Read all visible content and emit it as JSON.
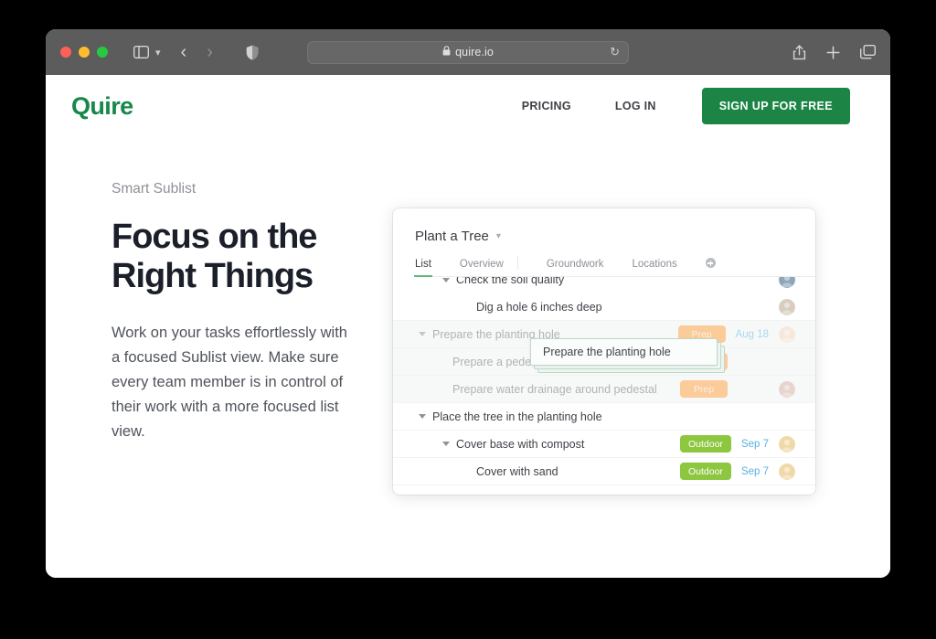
{
  "browser": {
    "url": "quire.io",
    "lock_icon": "lock-icon",
    "reload_icon": "reload-icon",
    "sidebar_icon": "sidebar-toggle-icon",
    "back_icon": "chevron-left-icon",
    "forward_icon": "chevron-right-icon",
    "shield_icon": "shield-icon",
    "share_icon": "share-icon",
    "new_tab_icon": "plus-icon",
    "tabs_icon": "tab-overview-icon",
    "traffic_lights": [
      "close-red",
      "minimize-yellow",
      "maximize-green"
    ]
  },
  "header": {
    "logo": "Quire",
    "nav": [
      {
        "label": "PRICING"
      },
      {
        "label": "LOG IN"
      }
    ],
    "cta": "SIGN UP FOR FREE"
  },
  "hero": {
    "eyebrow": "Smart Sublist",
    "title_line1": "Focus on the",
    "title_line2": "Right Things",
    "body": "Work on your tasks effortlessly with a focused Sublist view. Make sure every team member is in control of their work with a more focused list view."
  },
  "app": {
    "project_name": "Plant a Tree",
    "project_chevron": "⌄",
    "tabs": [
      {
        "label": "List",
        "active": true
      },
      {
        "label": "Overview",
        "active": false
      },
      {
        "label": "Groundwork",
        "active": false
      },
      {
        "label": "Locations",
        "active": false
      }
    ],
    "add_tab_label": "",
    "rows": [
      {
        "title": "Check the soil quality",
        "indent": 1,
        "caret": true,
        "badge": null,
        "badge_type": null,
        "date": null,
        "avatar": "#8ea6b8",
        "dimmed": false
      },
      {
        "title": "Dig a hole 6 inches deep",
        "indent": 2,
        "caret": false,
        "badge": null,
        "badge_type": null,
        "date": null,
        "avatar": "#d8cdbf",
        "dimmed": false
      },
      {
        "title": "Prepare the planting hole",
        "indent": 0,
        "caret": true,
        "badge": "Prep",
        "badge_type": "prep",
        "date": "Aug 18",
        "avatar": "#f5dcc8",
        "dimmed": true
      },
      {
        "title": "Prepare a pedestal",
        "indent": 1,
        "caret": false,
        "badge": "Prep",
        "badge_type": "prep",
        "date": null,
        "avatar": null,
        "dimmed": true
      },
      {
        "title": "Prepare water drainage around pedestal",
        "indent": 1,
        "caret": false,
        "badge": "Prep",
        "badge_type": "prep",
        "date": null,
        "avatar": "#d9b6ac",
        "dimmed": true
      },
      {
        "title": "Place the tree in the planting hole",
        "indent": 0,
        "caret": true,
        "badge": null,
        "badge_type": null,
        "date": null,
        "avatar": null,
        "dimmed": false
      },
      {
        "title": "Cover base with compost",
        "indent": 1,
        "caret": true,
        "badge": "Outdoor",
        "badge_type": "outdoor",
        "date": "Sep 7",
        "avatar": "#f0d9a8",
        "dimmed": false
      },
      {
        "title": "Cover with sand",
        "indent": 2,
        "caret": false,
        "badge": "Outdoor",
        "badge_type": "outdoor",
        "date": "Sep 7",
        "avatar": "#f0d9a8",
        "dimmed": false
      }
    ],
    "drag_ghost_label": "Prepare the planting hole"
  },
  "colors": {
    "brand_green": "#1c8545",
    "badge_outdoor": "#8dc63f",
    "badge_prep": "#fbbd7a",
    "due_date_blue": "#58b2e0",
    "tab_underline": "#62b97c"
  }
}
